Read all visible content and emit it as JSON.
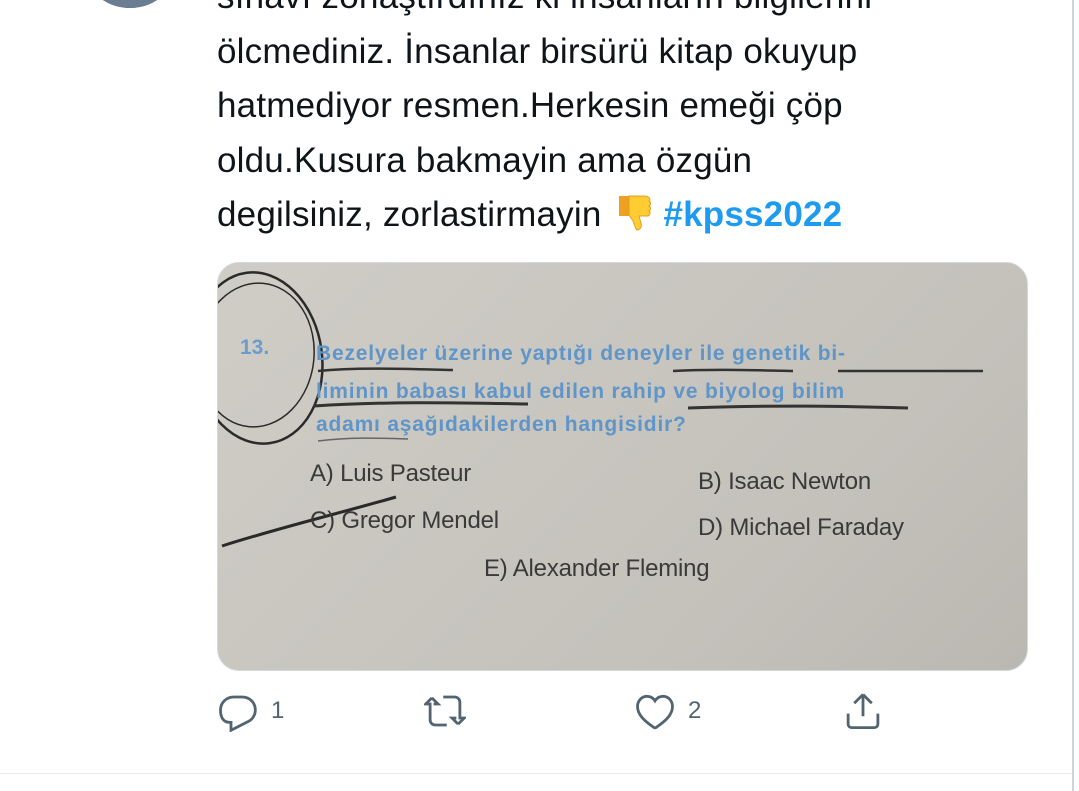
{
  "tweet": {
    "text_lines": [
      "sınavı zorlaştırdınız ki insanların bilgilerini",
      "ölcmediniz. İnsanlar birsürü kitap okuyup",
      "hatmediyor resmen.Herkesin emeği çöp",
      "oldu.Kusura bakmayin ama özgün",
      "degilsiniz, zorlastirmayin"
    ],
    "hashtag": "#kpss2022",
    "emoji_icon": "thumbs-down-icon"
  },
  "media": {
    "question_number": "13.",
    "question_lines": [
      "Bezelyeler üzerine yaptığı deneyler ile genetik bi-",
      "liminin babası kabul edilen rahip ve biyolog bilim",
      "adamı aşağıdakilerden hangisidir?"
    ],
    "options": {
      "a": "A) Luis Pasteur",
      "b": "B) Isaac Newton",
      "c": "C) Gregor Mendel",
      "d": "D) Michael Faraday",
      "e": "E) Alexander Fleming"
    }
  },
  "actions": {
    "reply_count": "1",
    "like_count": "2",
    "icons": [
      "reply-icon",
      "retweet-icon",
      "like-icon",
      "share-icon"
    ]
  },
  "colors": {
    "hashtag": "#1d9bf0",
    "text": "#0f1419",
    "muted": "#536471",
    "question_blue": "#5f95c8"
  }
}
